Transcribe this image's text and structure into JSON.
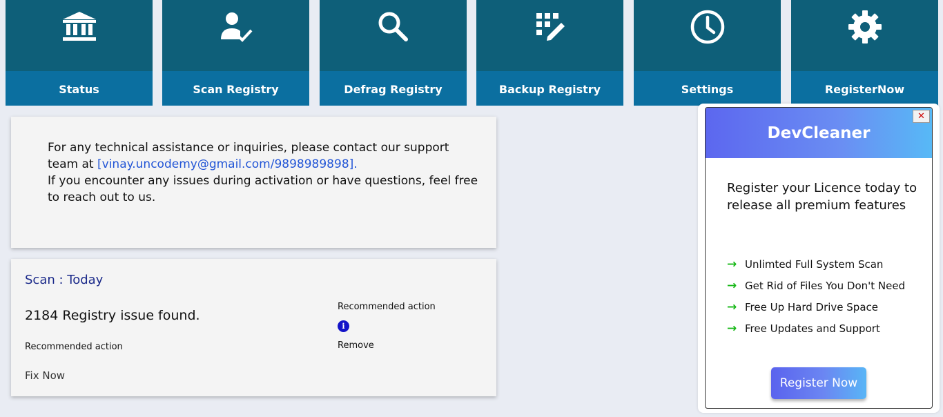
{
  "nav": {
    "items": [
      {
        "label": "Status",
        "icon": "bank-icon"
      },
      {
        "label": "Scan Registry",
        "icon": "user-check-icon"
      },
      {
        "label": "Defrag Registry",
        "icon": "search-icon"
      },
      {
        "label": "Backup Registry",
        "icon": "grid-edit-icon"
      },
      {
        "label": "Settings",
        "icon": "clock-icon"
      },
      {
        "label": "RegisterNow",
        "icon": "gear-icon"
      }
    ]
  },
  "support": {
    "line1": "For any technical assistance or inquiries, please contact our support team at ",
    "link": "[vinay.uncodemy@gmail.com/9898989898].",
    "line2": "If you encounter any issues during activation or have questions, feel free to reach out to us."
  },
  "scan": {
    "title": "Scan : Today",
    "issues": "2184 Registry issue found.",
    "recommended_left": "Recommended action",
    "fix": "Fix Now",
    "recommended_right": "Recommended action",
    "info": "i",
    "remove": "Remove"
  },
  "popup": {
    "title": "DevCleaner",
    "close": "✕",
    "description": "Register your Licence today to release all premium features",
    "features": [
      "Unlimted Full System Scan",
      "Get Rid of Files You Don't Need",
      "Free Up Hard Drive Space",
      "Free Updates and Support"
    ],
    "arrow": "→",
    "button": "Register Now"
  },
  "colors": {
    "nav_top": "#0e5f79",
    "nav_bottom": "#0b6fa0",
    "link": "#2255d6",
    "arrow": "#18b818"
  }
}
